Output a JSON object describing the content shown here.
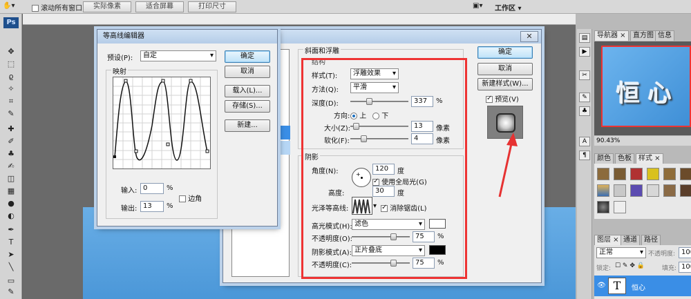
{
  "topbar": {
    "scroll_all_label": "滚动所有窗口",
    "actual_pixels": "实际像素",
    "fit_screen": "适合屏幕",
    "print_size": "打印尺寸",
    "workspace": "工作区 ▾"
  },
  "toolbox": {
    "logo": "Ps"
  },
  "contour_editor": {
    "title": "等高线编辑器",
    "preset_label": "预设(P):",
    "preset_value": "自定",
    "mapping_label": "映射",
    "ok": "确定",
    "cancel": "取消",
    "load": "载入(L)...",
    "save": "存储(S)...",
    "new": "新建...",
    "input_label": "输入:",
    "input_value": "0",
    "output_label": "输出:",
    "output_value": "13",
    "percent": "%",
    "corner_label": "边角",
    "corner_checked": false
  },
  "layer_style": {
    "section_bevel": "斜面和浮雕",
    "structure": "结构",
    "style_label": "样式(T):",
    "style_value": "浮雕效果",
    "technique_label": "方法(Q):",
    "technique_value": "平滑",
    "depth_label": "深度(D):",
    "depth_value": "337",
    "direction_label": "方向:",
    "dir_up": "上",
    "dir_down": "下",
    "size_label": "大小(Z):",
    "size_value": "13",
    "soften_label": "软化(F):",
    "soften_value": "4",
    "px_unit": "像素",
    "percent": "%",
    "shading": "阴影",
    "angle_label": "角度(N):",
    "angle_value": "120",
    "degree": "度",
    "global_light": "使用全局光(G)",
    "altitude_label": "高度:",
    "altitude_value": "30",
    "gloss_label": "光泽等高线:",
    "anti_alias": "消除锯齿(L)",
    "highlight_mode_label": "高光模式(H):",
    "highlight_mode_value": "滤色",
    "highlight_opacity_label": "不透明度(O):",
    "highlight_opacity_value": "75",
    "shadow_mode_label": "阴影模式(A):",
    "shadow_mode_value": "正片叠底",
    "shadow_opacity_label": "不透明度(C):",
    "shadow_opacity_value": "75",
    "ok": "确定",
    "cancel": "取消",
    "new_style": "新建样式(W)...",
    "preview": "预览(V)",
    "highlight_color": "#ffffff",
    "shadow_color": "#000000",
    "depth_level": 0.3,
    "size_level": 0.05,
    "soften_level": 0.2,
    "highlight_opacity_level": 0.75,
    "shadow_opacity_level": 0.75
  },
  "panels": {
    "navigator_tab": "导航器",
    "histogram_tab": "直方图",
    "info_tab": "信息",
    "zoom": "90.43%",
    "nav_preview_text": "恒 心",
    "color_tab": "颜色",
    "swatches_tab": "色板",
    "styles_tab": "样式",
    "layers_tab": "图层",
    "channels_tab": "通道",
    "paths_tab": "路径",
    "blend_mode": "正常",
    "opacity_label": "不透明度:",
    "opacity_value": "100",
    "lock_label": "锁定:",
    "fill_label": "填充:",
    "fill_value": "100",
    "layer_name": "恒心",
    "layer_type": "T"
  },
  "colors": {
    "highlight_red": "#e63232",
    "arrow_red": "#e63232",
    "canvas_blue": "#4b97d8"
  }
}
